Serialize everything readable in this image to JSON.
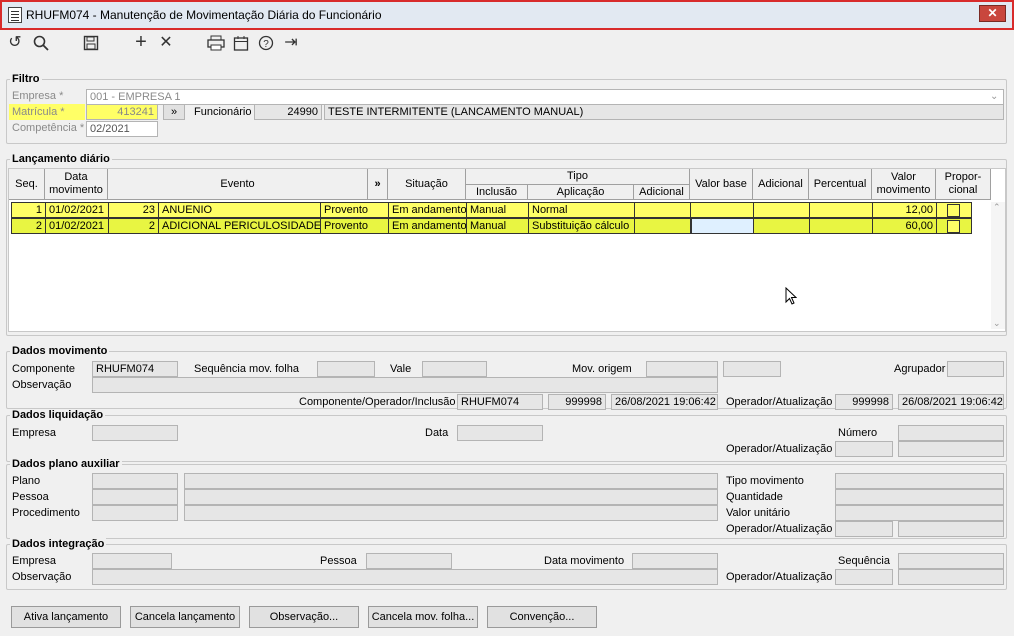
{
  "window": {
    "title": "RHUFM074 - Manutenção de Movimentação Diária do Funcionário",
    "close": "✕"
  },
  "toolbar": {
    "refresh": "↺",
    "search": "⚲",
    "save": "💾",
    "add": "+",
    "remove": "✕",
    "print": "🖶",
    "calendar": "📅",
    "help": "?",
    "exit": "⇥"
  },
  "filtro": {
    "legend": "Filtro",
    "empresa_label": "Empresa *",
    "empresa_value": "001 - EMPRESA 1",
    "matricula_label": "Matrícula *",
    "matricula_value": "413241",
    "lookup": "»",
    "competencia_label": "Competência *",
    "competencia_value": "02/2021",
    "funcionario_label": "Funcionário",
    "funcionario_code": "24990",
    "funcionario_name": "TESTE INTERMITENTE (LANCAMENTO MANUAL)"
  },
  "lancamento": {
    "legend": "Lançamento diário",
    "headers": {
      "seq": "Seq.",
      "data": "Data\nmovimento",
      "evento": "Evento",
      "more": "»",
      "situacao": "Situação",
      "tipo": "Tipo",
      "inclusao": "Inclusão",
      "aplicacao": "Aplicação",
      "adicional_tipo": "Adicional",
      "valor_base": "Valor base",
      "adicional": "Adicional",
      "percentual": "Percentual",
      "valor_mov": "Valor\nmovimento",
      "proporcional": "Propor-\ncional"
    },
    "rows": [
      {
        "seq": "1",
        "data": "01/02/2021",
        "ev_code": "23",
        "ev_name": "ANUENIO",
        "tipo_ev": "Provento",
        "situacao": "Em andamento",
        "inclusao": "Manual",
        "aplicacao": "Normal",
        "adicional_tipo": "",
        "valor_base": "",
        "adicional": "",
        "percentual": "",
        "valor": "12,00"
      },
      {
        "seq": "2",
        "data": "01/02/2021",
        "ev_code": "2",
        "ev_name": "ADICIONAL PERICULOSIDADE",
        "tipo_ev": "Provento",
        "situacao": "Em andamento",
        "inclusao": "Manual",
        "aplicacao": "Substituição cálculo",
        "adicional_tipo": "",
        "valor_base": "",
        "adicional": "",
        "percentual": "",
        "valor": "60,00"
      }
    ]
  },
  "dados_mov": {
    "legend": "Dados movimento",
    "componente_label": "Componente",
    "componente_value": "RHUFM074",
    "seq_label": "Sequência mov. folha",
    "vale_label": "Vale",
    "mov_origem_label": "Mov. origem",
    "agrupador_label": "Agrupador",
    "obs_label": "Observação",
    "comp_op_inc_label": "Componente/Operador/Inclusão",
    "comp_inc": "RHUFM074",
    "op_inc": "999998",
    "dt_inc": "26/08/2021 19:06:42",
    "op_atu_label": "Operador/Atualização",
    "op_atu": "999998",
    "dt_atu": "26/08/2021 19:06:42"
  },
  "dados_liq": {
    "legend": "Dados liquidação",
    "empresa_label": "Empresa",
    "data_label": "Data",
    "numero_label": "Número",
    "op_atu_label": "Operador/Atualização"
  },
  "dados_plano": {
    "legend": "Dados plano auxiliar",
    "plano_label": "Plano",
    "pessoa_label": "Pessoa",
    "proc_label": "Procedimento",
    "tipo_mov_label": "Tipo movimento",
    "quantidade_label": "Quantidade",
    "valor_unit_label": "Valor unitário",
    "op_atu_label": "Operador/Atualização"
  },
  "dados_int": {
    "legend": "Dados integração",
    "empresa_label": "Empresa",
    "pessoa_label": "Pessoa",
    "data_mov_label": "Data movimento",
    "sequencia_label": "Sequência",
    "obs_label": "Observação",
    "op_atu_label": "Operador/Atualização"
  },
  "buttons": {
    "ativa": "Ativa lançamento",
    "cancela": "Cancela lançamento",
    "observacao": "Observação...",
    "cancela_folha": "Cancela mov. folha...",
    "convencao": "Convenção..."
  }
}
